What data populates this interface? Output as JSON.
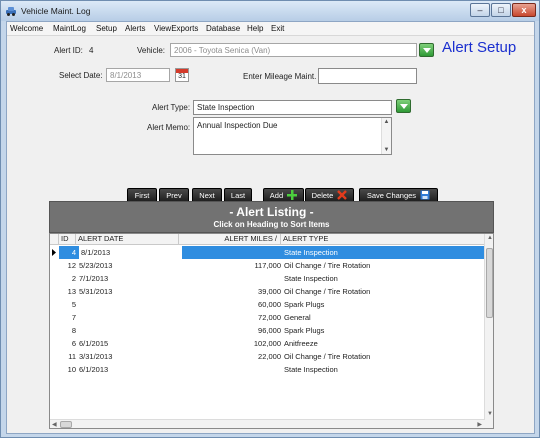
{
  "window": {
    "title": "Vehicle Maint. Log",
    "min": "–",
    "max": "□",
    "close": "x"
  },
  "menu": [
    "Welcome",
    "MaintLog",
    "Setup",
    "Alerts",
    "ViewExports",
    "Database",
    "Help",
    "Exit"
  ],
  "form": {
    "alert_id_label": "Alert ID:",
    "alert_id_value": "4",
    "vehicle_label": "Vehicle:",
    "vehicle_value": "2006 - Toyota Senica (Van)",
    "heading": "Alert Setup",
    "select_date_label": "Select Date:",
    "select_date_value": "8/1/2013",
    "calendar_day": "31",
    "mileage_label": "Enter Mileage Maint.",
    "mileage_value": "",
    "alert_type_label": "Alert Type:",
    "alert_type_value": "State Inspection",
    "alert_memo_label": "Alert Memo:",
    "alert_memo_value": "Annual Inspection Due"
  },
  "nav_buttons": {
    "first": "First",
    "prev": "Prev",
    "next": "Next",
    "last": "Last",
    "add": "Add",
    "delete": "Delete",
    "save": "Save  Changes"
  },
  "listing": {
    "title": "- Alert Listing -",
    "subtitle": "Click on Heading to Sort Items",
    "columns": [
      "ID",
      "ALERT DATE",
      "ALERT MILES /",
      "ALERT TYPE"
    ],
    "rows": [
      {
        "id": "4",
        "date": "8/1/2013",
        "miles": "",
        "type": "State Inspection",
        "selected": true
      },
      {
        "id": "12",
        "date": "5/23/2013",
        "miles": "117,000",
        "type": "Oil Change / Tire Rotation"
      },
      {
        "id": "2",
        "date": "7/1/2013",
        "miles": "",
        "type": "State Inspection"
      },
      {
        "id": "13",
        "date": "5/31/2013",
        "miles": "39,000",
        "type": "Oil Change / Tire Rotation"
      },
      {
        "id": "5",
        "date": "",
        "miles": "60,000",
        "type": "Spark Plugs"
      },
      {
        "id": "7",
        "date": "",
        "miles": "72,000",
        "type": "General"
      },
      {
        "id": "8",
        "date": "",
        "miles": "96,000",
        "type": "Spark Plugs"
      },
      {
        "id": "6",
        "date": "6/1/2015",
        "miles": "102,000",
        "type": "Anitfreeze"
      },
      {
        "id": "11",
        "date": "3/31/2013",
        "miles": "22,000",
        "type": "Oil Change / Tire Rotation"
      },
      {
        "id": "10",
        "date": "6/1/2013",
        "miles": "",
        "type": "State Inspection"
      }
    ]
  }
}
